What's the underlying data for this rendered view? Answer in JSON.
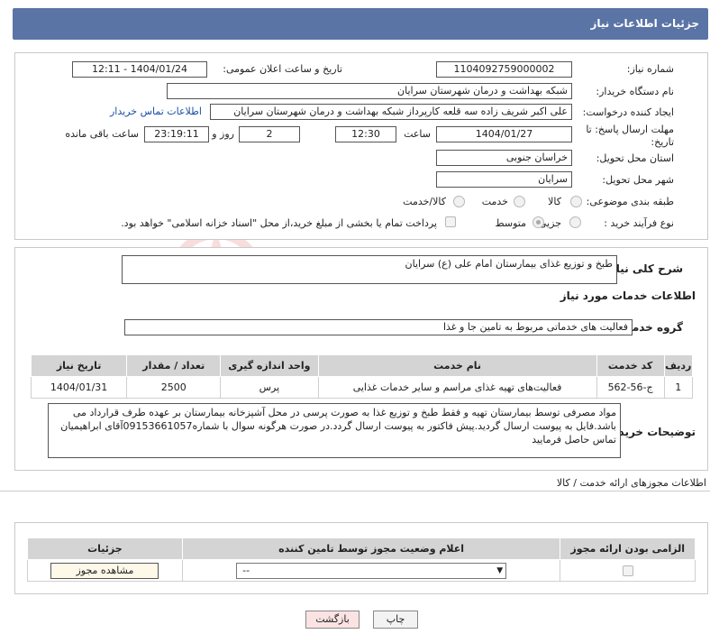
{
  "header": {
    "title": "جزئیات اطلاعات نیاز"
  },
  "form": {
    "need_number_label": "شماره نیاز:",
    "need_number": "1104092759000002",
    "announce_label": "تاریخ و ساعت اعلان عمومی:",
    "announce_value": "1404/01/24 - 12:11",
    "buyer_org_label": "نام دستگاه خریدار:",
    "buyer_org": "شبکه بهداشت و درمان شهرستان سرایان",
    "creator_label": "ایجاد کننده درخواست:",
    "creator": "علی اکبر شریف زاده سه قلعه کارپرداز شبکه بهداشت و درمان شهرستان سرایان",
    "contact_link": "اطلاعات تماس خریدار",
    "deadline_label": "مهلت ارسال پاسخ: تا تاریخ:",
    "deadline_date": "1404/01/27",
    "time_label": "ساعت",
    "deadline_time": "12:30",
    "days_value": "2",
    "days_label": "روز و",
    "remaining_time": "23:19:11",
    "remaining_label": "ساعت باقی مانده",
    "province_label": "استان محل تحویل:",
    "province": "خراسان جنوبی",
    "city_label": "شهر محل تحویل:",
    "city": "سرایان",
    "category_label": "طبقه بندی موضوعی:",
    "category_options": [
      "کالا",
      "خدمت",
      "کالا/خدمت"
    ],
    "process_label": "نوع فرآیند خرید :",
    "process_options": [
      "جزیی",
      "متوسط"
    ],
    "treasury_note": "پرداخت تمام یا بخشی از مبلغ خرید،از محل \"اسناد خزانه اسلامی\" خواهد بود."
  },
  "summary": {
    "label": "شرح کلی نیاز:",
    "value": "طبخ و توزیع غذای بیمارستان امام علی (ع) سرایان",
    "services_title": "اطلاعات خدمات مورد نیاز",
    "group_label": "گروه خدمت:",
    "group_value": "فعالیت های خدماتی مربوط به تامین جا و غذا"
  },
  "services_table": {
    "headers": [
      "ردیف",
      "کد خدمت",
      "نام خدمت",
      "واحد اندازه گیری",
      "تعداد / مقدار",
      "تاریخ نیاز"
    ],
    "rows": [
      [
        "1",
        "ج-56-562",
        "فعالیت‌های تهیه غذای مراسم و سایر خدمات غذایی",
        "پرس",
        "2500",
        "1404/01/31"
      ]
    ]
  },
  "buyer_notes": {
    "label": "توضیحات خریدار:",
    "text": "مواد مصرفی توسط بیمارستان تهیه و فقط طبخ و توزیع غذا به صورت پرسی در محل آشپزخانه بیمارستان بر عهده طرف قرارداد می باشد.فایل به پیوست ارسال گردید.پیش فاکتور به پیوست ارسال گردد.در صورت هرگونه سوال با شماره09153661057آقای ابراهیمیان تماس حاصل فرمایید"
  },
  "permits": {
    "title": "اطلاعات مجوزهای ارائه خدمت / کالا",
    "headers": [
      "الزامی بودن ارائه مجوز",
      "اعلام وضعیت مجوز توسط تامین کننده",
      "جزئیات"
    ],
    "select_value": "--",
    "view_button": "مشاهده مجوز"
  },
  "footer": {
    "print_button": "چاپ",
    "back_button": "بازگشت"
  },
  "watermark": {
    "text": "AriaTender.neT"
  },
  "colors": {
    "title_bar": "#5b74a6",
    "link": "#1a4fa3",
    "back_button_bg": "#fbe3e3"
  }
}
